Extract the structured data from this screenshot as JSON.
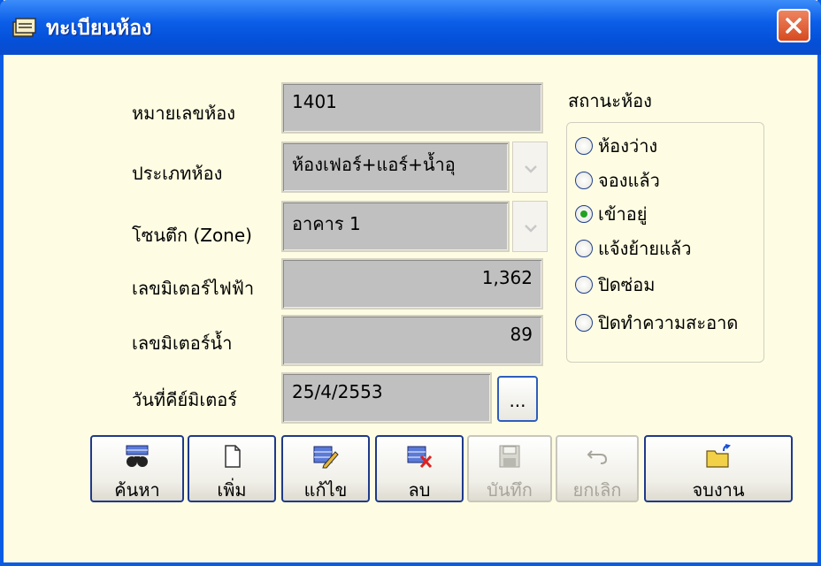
{
  "window": {
    "title": "ทะเบียนห้อง",
    "icon": "drawer-icon"
  },
  "form": {
    "room_number": {
      "label": "หมายเลขห้อง",
      "value": "1401"
    },
    "room_type": {
      "label": "ประเภทห้อง",
      "value": "ห้องเฟอร์+แอร์+น้ำอุ"
    },
    "zone": {
      "label": "โซนตึก (Zone)",
      "value": "อาคาร 1"
    },
    "electric_meter": {
      "label": "เลขมิเตอร์ไฟฟ้า",
      "value": "1,362"
    },
    "water_meter": {
      "label": "เลขมิเตอร์น้ำ",
      "value": "89"
    },
    "meter_date": {
      "label": "วันที่คีย์มิเตอร์",
      "value": "25/4/2553",
      "browse_label": "..."
    }
  },
  "status": {
    "title": "สถานะห้อง",
    "options": [
      {
        "label": "ห้องว่าง",
        "checked": false
      },
      {
        "label": "จองแล้ว",
        "checked": false
      },
      {
        "label": "เข้าอยู่",
        "checked": true
      },
      {
        "label": "แจ้งย้ายแล้ว",
        "checked": false
      },
      {
        "label": "ปิดซ่อม",
        "checked": false
      },
      {
        "label": "ปิดทำความสะอาด",
        "checked": false
      }
    ]
  },
  "toolbar": {
    "search": "ค้นหา",
    "add": "เพิ่ม",
    "edit": "แก้ไข",
    "delete": "ลบ",
    "save": "บันทึก",
    "cancel": "ยกเลิก",
    "exit": "จบงาน"
  }
}
